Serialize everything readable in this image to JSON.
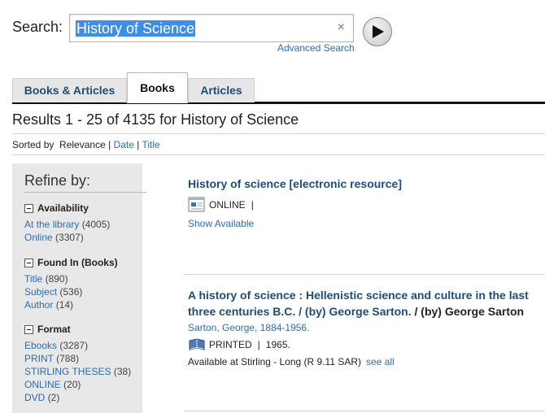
{
  "search": {
    "label": "Search:",
    "value": "History of Science",
    "clear_glyph": "×",
    "advanced_label": "Advanced Search"
  },
  "tabs": [
    {
      "label": "Books & Articles",
      "active": false
    },
    {
      "label": "Books",
      "active": true
    },
    {
      "label": "Articles",
      "active": false
    }
  ],
  "results": {
    "summary": "Results 1 - 25 of 4135 for History of Science",
    "sort_label": "Sorted by",
    "sort_current": "Relevance",
    "sort_date": "Date",
    "sort_title": "Title"
  },
  "refine": {
    "heading": "Refine by:",
    "facets": [
      {
        "heading": "Availability",
        "items": [
          {
            "label": "At the library",
            "count": "(4005)"
          },
          {
            "label": "Online",
            "count": "(3307)"
          }
        ]
      },
      {
        "heading": "Found In (Books)",
        "items": [
          {
            "label": "Title",
            "count": "(890)"
          },
          {
            "label": "Subject",
            "count": "(536)"
          },
          {
            "label": "Author",
            "count": "(14)"
          }
        ]
      },
      {
        "heading": "Format",
        "items": [
          {
            "label": "Ebooks",
            "count": "(3287)"
          },
          {
            "label": "PRINT",
            "count": "(788)"
          },
          {
            "label": "STIRLING THESES",
            "count": "(38)"
          },
          {
            "label": "ONLINE",
            "count": "(20)"
          },
          {
            "label": "DVD",
            "count": "(2)"
          }
        ]
      }
    ]
  },
  "records": [
    {
      "title": "History of science [electronic resource]",
      "format_icon": "online-resource-icon",
      "format": "ONLINE",
      "pipe": "|",
      "show_available": "Show Available"
    },
    {
      "title_part1": "A history of science : Hellenistic science and culture in the last three centuries B.C. / (by) George Sarton.",
      "title_part2": "/ (by) George Sarton",
      "author": "Sarton, George, 1884-1956.",
      "format_icon": "printed-book-icon",
      "format": "PRINTED",
      "pipe": "|",
      "year": "1965.",
      "availability": "Available at Stirling - Long (R 9.11 SAR)",
      "see_all": "see all"
    }
  ],
  "colors": {
    "link": "#2a6db5",
    "title": "#1d4d7a",
    "highlight": "#3d8ee6",
    "panel": "#e8e8e8"
  }
}
